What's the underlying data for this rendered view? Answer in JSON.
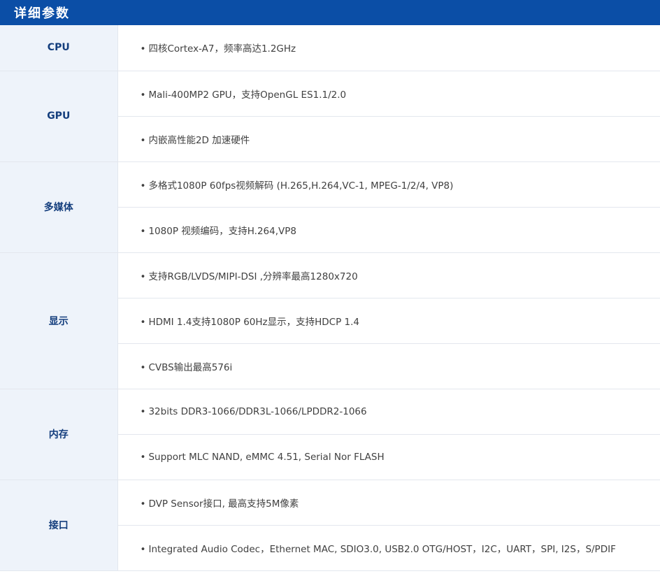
{
  "header": {
    "title": "详细参数"
  },
  "rows": [
    {
      "category": "CPU",
      "items": [
        "四核Cortex-A7，频率高达1.2GHz"
      ]
    },
    {
      "category": "GPU",
      "items": [
        "Mali-400MP2 GPU，支持OpenGL ES1.1/2.0",
        "内嵌高性能2D 加速硬件"
      ]
    },
    {
      "category": "多媒体",
      "items": [
        "多格式1080P 60fps视频解码 (H.265,H.264,VC-1, MPEG-1/2/4, VP8)",
        "1080P 视频编码，支持H.264,VP8"
      ]
    },
    {
      "category": "显示",
      "items": [
        "支持RGB/LVDS/MIPI-DSI ,分辨率最高1280x720",
        "HDMI 1.4支持1080P 60Hz显示，支持HDCP 1.4",
        "CVBS输出最高576i"
      ]
    },
    {
      "category": "内存",
      "items": [
        "32bits DDR3-1066/DDR3L-1066/LPDDR2-1066",
        "Support MLC NAND, eMMC 4.51, Serial Nor FLASH"
      ]
    },
    {
      "category": "接口",
      "items": [
        "DVP Sensor接口, 最高支持5M像素",
        "Integrated Audio Codec，Ethernet MAC, SDIO3.0, USB2.0 OTG/HOST，I2C，UART，SPI, I2S，S/PDIF"
      ]
    }
  ],
  "bullet_char": "•",
  "colors": {
    "header_bg": "#0b4ea6",
    "category_bg": "#eef3fa",
    "category_text": "#143e7d",
    "value_text": "#404040",
    "border": "#e3e7ee"
  }
}
